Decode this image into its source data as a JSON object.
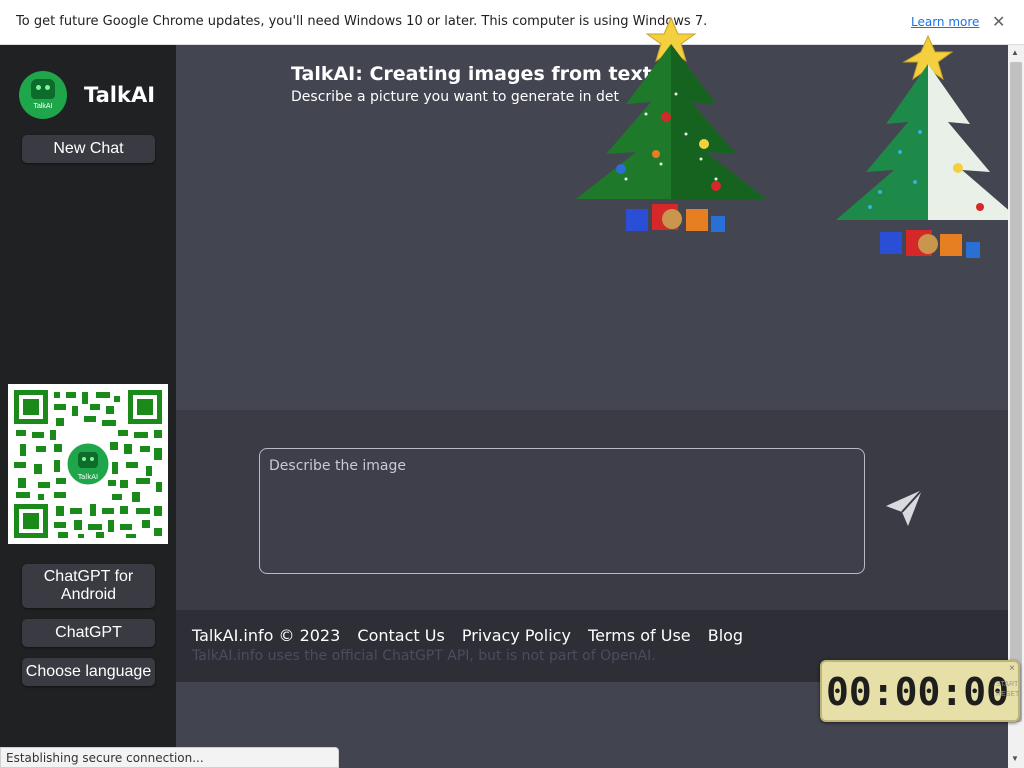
{
  "infobar": {
    "message": "To get future Google Chrome updates, you'll need Windows 10 or later. This computer is using Windows 7.",
    "learn_more": "Learn more",
    "close": "✕"
  },
  "sidebar": {
    "logo_text": "TalkAI",
    "brand": "TalkAI",
    "new_chat": "New Chat",
    "qr_logo_text": "TalkAI",
    "android_line1": "ChatGPT for",
    "android_line2": "Android",
    "chatgpt": "ChatGPT",
    "language": "Choose language"
  },
  "main": {
    "title": "TalkAI: Creating images from text",
    "subtitle": "Describe a picture you want to generate in det",
    "placeholder": "Describe the image"
  },
  "footer": {
    "copyright": "TalkAI.info © 2023",
    "contact": "Contact Us",
    "privacy": "Privacy Policy",
    "terms": "Terms of Use",
    "blog": "Blog",
    "disclaimer": "TalkAI.info uses the official ChatGPT API, but is not part of OpenAI."
  },
  "status_bar": "Establishing secure connection...",
  "timer": {
    "display": "00:00:00",
    "start": "START",
    "reset": "RESET",
    "close": "×"
  },
  "colors": {
    "sidebar_bg": "#202123",
    "main_bg": "#434551",
    "accent_green": "#1fa64a",
    "link_blue": "#1a73e8"
  }
}
